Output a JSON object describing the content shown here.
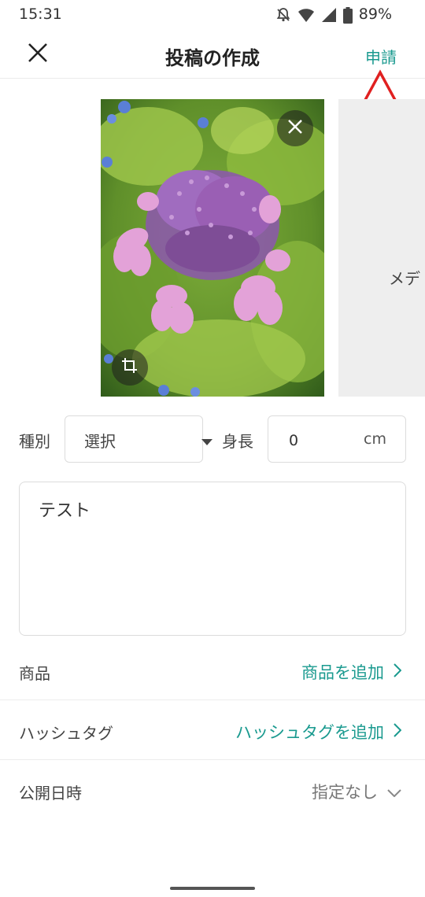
{
  "status_bar": {
    "time": "15:31",
    "battery": "89%",
    "icons": [
      "bell-off-icon",
      "wifi-icon",
      "signal-icon",
      "battery-icon"
    ]
  },
  "header": {
    "title": "投稿の作成",
    "submit_label": "申請",
    "close_icon": "close-icon"
  },
  "colors": {
    "accent": "#1a9a8f",
    "annotation": "#e02020",
    "border": "#dcdcdc"
  },
  "media": {
    "add_media_label": "メデ"
  },
  "form": {
    "type_label": "種別",
    "type_value": "選択",
    "height_label": "身長",
    "height_value": "0",
    "height_unit": "cm",
    "body_text": "テスト"
  },
  "rows": {
    "products": {
      "label": "商品",
      "action": "商品を追加"
    },
    "hashtags": {
      "label": "ハッシュタグ",
      "action": "ハッシュタグを追加"
    },
    "publish_date": {
      "label": "公開日時",
      "value": "指定なし"
    }
  }
}
